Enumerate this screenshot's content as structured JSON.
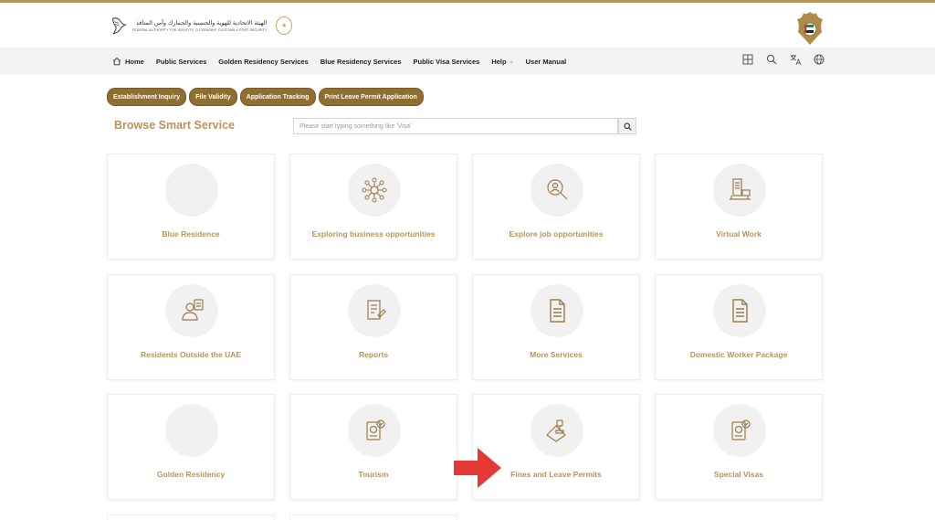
{
  "header": {
    "logo_arabic": "الهيئة الاتحادية للهوية والجنسية والجمارك وأمن المنافذ",
    "logo_english": "FEDERAL AUTHORITY FOR IDENTITY, CITIZENSHIP, CUSTOMS & PORT SECURITY"
  },
  "nav": {
    "items": [
      {
        "label": "Home"
      },
      {
        "label": "Public Services"
      },
      {
        "label": "Golden Residency Services"
      },
      {
        "label": "Blue Residency Services"
      },
      {
        "label": "Public Visa Services"
      },
      {
        "label": "Help"
      },
      {
        "label": "User Manual"
      }
    ],
    "icons": [
      "grid-icon",
      "search-icon",
      "translate-icon",
      "globe-icon"
    ]
  },
  "quick_links": [
    "Establishment Inquiry",
    "File Validity",
    "Application Tracking",
    "Print Leave Permit Application"
  ],
  "browse": {
    "title": "Browse Smart Service",
    "search_placeholder": "Please start typing something like 'Visa'"
  },
  "services": [
    {
      "label": "Blue Residence",
      "icon": "empty-icon"
    },
    {
      "label": "Exploring business opportunities",
      "icon": "network-icon"
    },
    {
      "label": "Explore job opportunities",
      "icon": "job-search-icon"
    },
    {
      "label": "Virtual Work",
      "icon": "remote-work-icon"
    },
    {
      "label": "Residents Outside the UAE",
      "icon": "resident-icon"
    },
    {
      "label": "Reports",
      "icon": "report-icon"
    },
    {
      "label": "More Services",
      "icon": "document-icon"
    },
    {
      "label": "Domestic Worker Package",
      "icon": "document-icon"
    },
    {
      "label": "Golden Residency",
      "icon": "empty-icon"
    },
    {
      "label": "Tourism",
      "icon": "passport-icon"
    },
    {
      "label": "Fines and Leave Permits",
      "icon": "stamp-icon"
    },
    {
      "label": "Special Visas",
      "icon": "passport-icon"
    }
  ],
  "colors": {
    "accent": "#b8945a",
    "button": "#8f6e32",
    "arrow": "#e53935"
  }
}
